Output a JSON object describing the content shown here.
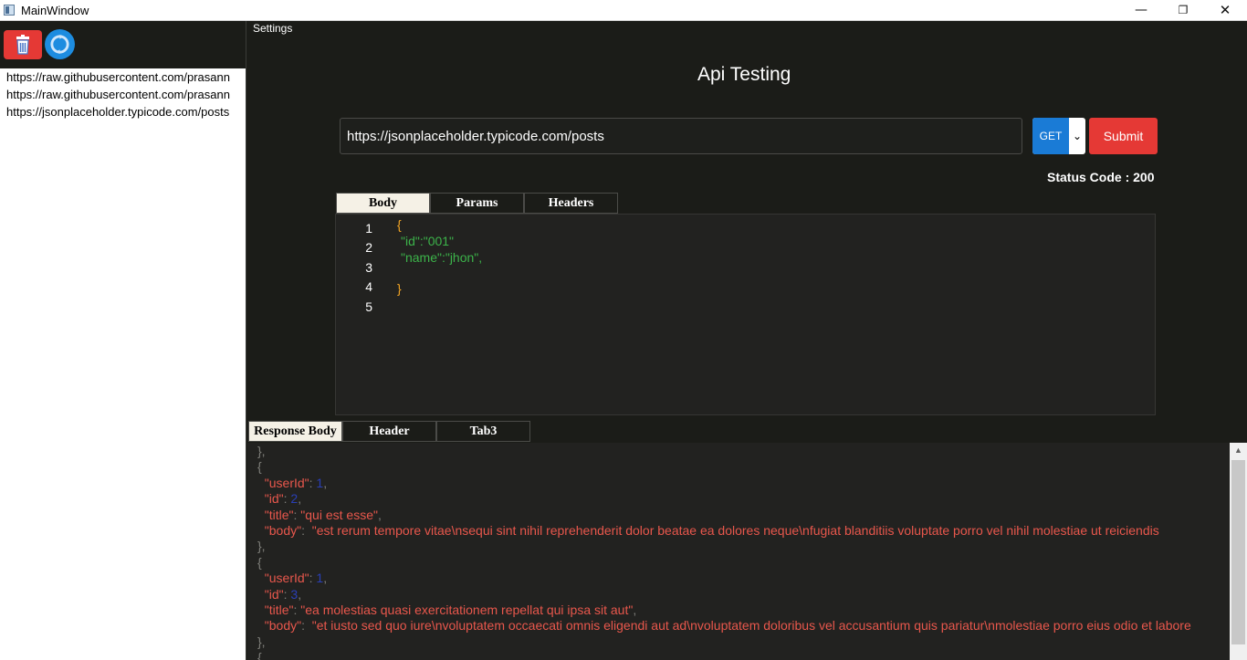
{
  "window": {
    "title": "MainWindow",
    "minimize": "—",
    "maximize": "❐",
    "close": "✕"
  },
  "sidebar": {
    "history": [
      "https://raw.githubusercontent.com/prasann",
      "https://raw.githubusercontent.com/prasann",
      "https://jsonplaceholder.typicode.com/posts"
    ]
  },
  "menu": {
    "settings": "Settings"
  },
  "main": {
    "title": "Api Testing",
    "url_value": "https://jsonplaceholder.typicode.com/posts",
    "method": "GET",
    "submit": "Submit",
    "status": "Status Code : 200",
    "request_tabs": [
      "Body",
      "Params",
      "Headers"
    ],
    "editor": {
      "line_numbers": [
        "1",
        "2",
        "3",
        "4",
        "5"
      ],
      "lines": [
        "{",
        "\"id\":\"001\"",
        "\"name\":\"jhon\",",
        "}"
      ]
    },
    "response_tabs": [
      "Response Body",
      "Header",
      "Tab3"
    ],
    "response_lines": [
      {
        "p": "},",
        "k": "",
        "v": "",
        "s": "",
        "vt": ""
      },
      {
        "p": "{",
        "k": "",
        "v": "",
        "s": "",
        "vt": ""
      },
      {
        "p": "  ",
        "k": "\"userId\"",
        "s": ": ",
        "v": "1",
        "vt": "num",
        "e": ","
      },
      {
        "p": "  ",
        "k": "\"id\"",
        "s": ": ",
        "v": "2",
        "vt": "num",
        "e": ","
      },
      {
        "p": "  ",
        "k": "\"title\"",
        "s": ": ",
        "v": "\"qui est esse\"",
        "vt": "str",
        "e": ","
      },
      {
        "p": "  ",
        "k": "\"body\"",
        "s": ":  ",
        "v": "\"est rerum tempore vitae\\nsequi sint nihil reprehenderit dolor beatae ea dolores neque\\nfugiat blanditiis voluptate porro vel nihil molestiae ut reiciendis",
        "vt": "str",
        "e": ""
      },
      {
        "p": "},",
        "k": "",
        "v": "",
        "s": "",
        "vt": ""
      },
      {
        "p": "{",
        "k": "",
        "v": "",
        "s": "",
        "vt": ""
      },
      {
        "p": "  ",
        "k": "\"userId\"",
        "s": ": ",
        "v": "1",
        "vt": "num",
        "e": ","
      },
      {
        "p": "  ",
        "k": "\"id\"",
        "s": ": ",
        "v": "3",
        "vt": "num",
        "e": ","
      },
      {
        "p": "  ",
        "k": "\"title\"",
        "s": ": ",
        "v": "\"ea molestias quasi exercitationem repellat qui ipsa sit aut\"",
        "vt": "str",
        "e": ","
      },
      {
        "p": "  ",
        "k": "\"body\"",
        "s": ":  ",
        "v": "\"et iusto sed quo iure\\nvoluptatem occaecati omnis eligendi aut ad\\nvoluptatem doloribus vel accusantium quis pariatur\\nmolestiae porro eius odio et labore",
        "vt": "str",
        "e": ""
      },
      {
        "p": "},",
        "k": "",
        "v": "",
        "s": "",
        "vt": ""
      },
      {
        "p": "{",
        "k": "",
        "v": "",
        "s": "",
        "vt": ""
      }
    ]
  },
  "colors": {
    "accent_red": "#e53935",
    "accent_blue": "#1a7bd6",
    "bg": "#1b1c18"
  },
  "icons": {
    "delete": "trash-icon",
    "refresh": "refresh-icon"
  }
}
